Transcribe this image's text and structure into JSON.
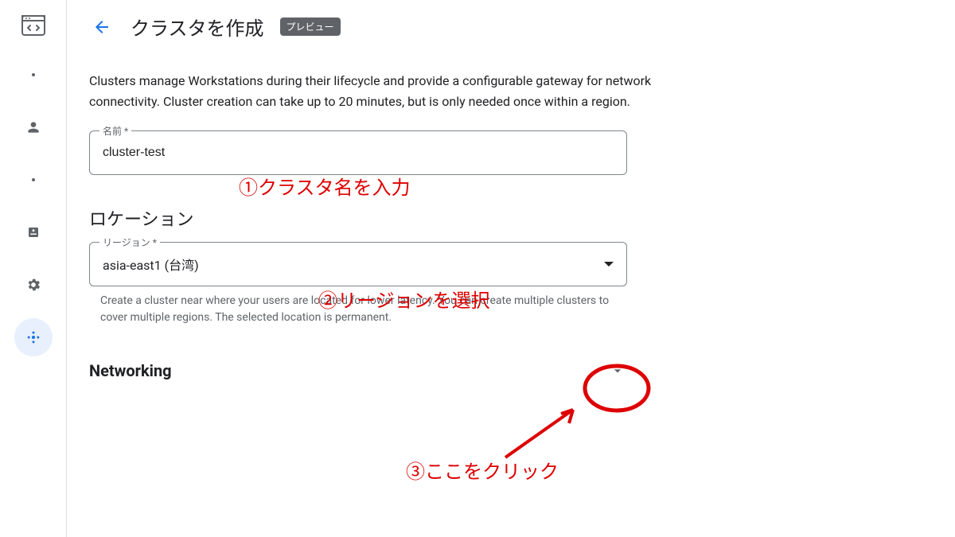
{
  "header": {
    "title": "クラスタを作成",
    "badge": "プレビュー"
  },
  "description": "Clusters manage Workstations during their lifecycle and provide a configurable gateway for network connectivity. Cluster creation can take up to 20 minutes, but is only needed once within a region.",
  "name_field": {
    "label": "名前 *",
    "value": "cluster-test"
  },
  "location": {
    "section_title": "ロケーション",
    "region_label": "リージョン *",
    "region_value": "asia-east1 (台湾)",
    "helper": "Create a cluster near where your users are located for lower latency. You can create multiple clusters to cover multiple regions. The selected location is permanent."
  },
  "networking": {
    "title": "Networking"
  },
  "annotations": {
    "a1": "①クラスタ名を入力",
    "a2": "②リージョンを選択",
    "a3": "③ここをクリック"
  },
  "sidebar_icons": [
    "code",
    "dot",
    "person",
    "dot",
    "storage",
    "gear",
    "cluster"
  ]
}
